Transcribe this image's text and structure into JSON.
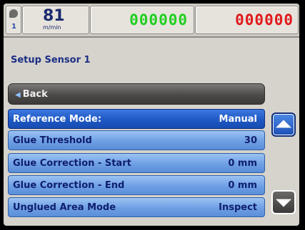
{
  "status_bar": {
    "sensor_number": "1",
    "speed_value": "81",
    "speed_unit": "m/min",
    "good_count": "000000",
    "bad_count": "000000"
  },
  "page_title": "Setup Sensor 1",
  "back_label": "Back",
  "settings": [
    {
      "label": "Reference Mode:",
      "value": "Manual",
      "selected": true
    },
    {
      "label": "Glue Threshold",
      "value": "30",
      "selected": false
    },
    {
      "label": "Glue Correction - Start",
      "value": "0 mm",
      "selected": false
    },
    {
      "label": "Glue Correction - End",
      "value": "0 mm",
      "selected": false
    },
    {
      "label": "Unglued Area Mode",
      "value": "Inspect",
      "selected": false
    }
  ],
  "colors": {
    "good_count": "#1fcf1f",
    "bad_count": "#e0191c",
    "selected_row": "#1f58c3",
    "row": "#6e9fe4"
  },
  "icons": {
    "sensor": "sensor-icon",
    "back": "chevron-left-icon",
    "scroll_up": "arrow-up-icon",
    "scroll_down": "arrow-down-icon"
  }
}
